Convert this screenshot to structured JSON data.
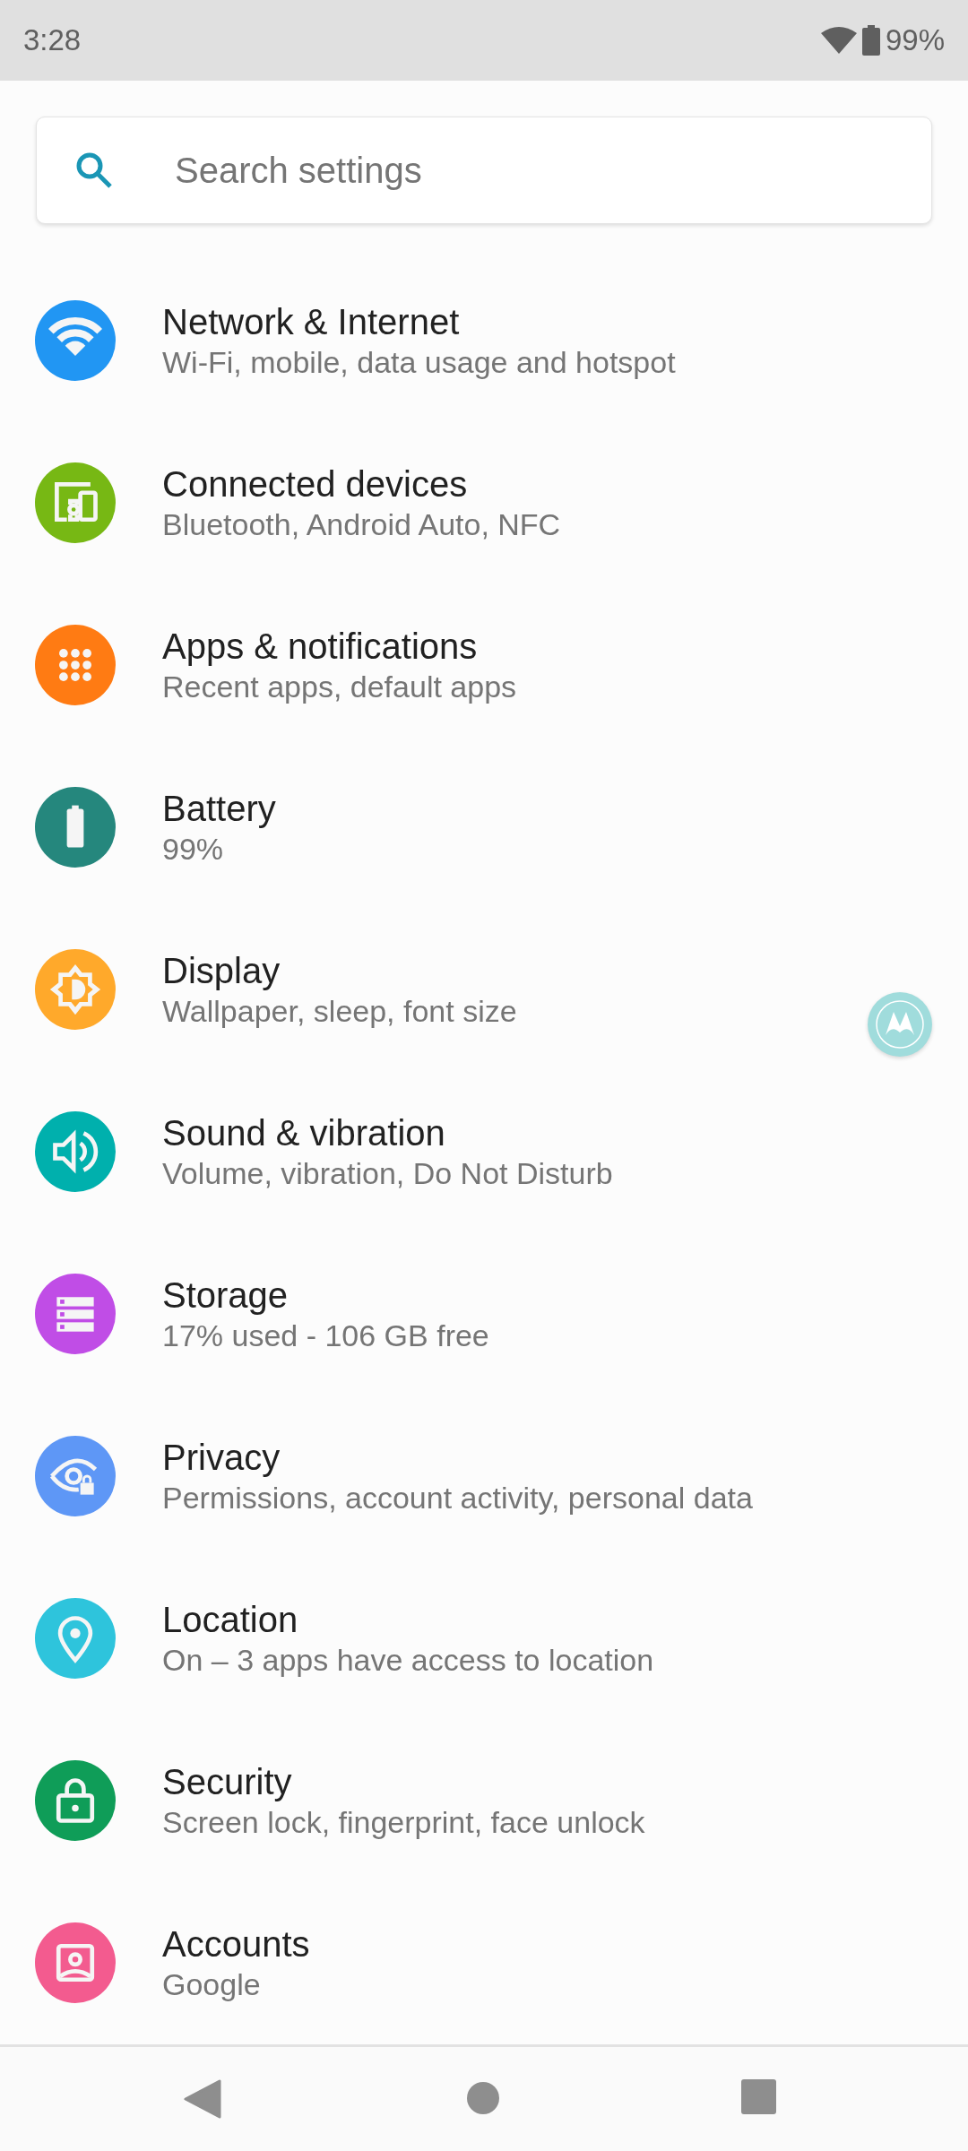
{
  "status_bar": {
    "time": "3:28",
    "battery": "99%"
  },
  "search": {
    "placeholder": "Search settings"
  },
  "settings": [
    {
      "title": "Network & Internet",
      "subtitle": "Wi-Fi, mobile, data usage and hotspot",
      "color": "#2196f3"
    },
    {
      "title": "Connected devices",
      "subtitle": "Bluetooth, Android Auto, NFC",
      "color": "#77b814"
    },
    {
      "title": "Apps & notifications",
      "subtitle": "Recent apps, default apps",
      "color": "#ff7b13"
    },
    {
      "title": "Battery",
      "subtitle": "99%",
      "color": "#25877d"
    },
    {
      "title": "Display",
      "subtitle": "Wallpaper, sleep, font size",
      "color": "#ffa92b"
    },
    {
      "title": "Sound & vibration",
      "subtitle": "Volume, vibration, Do Not Disturb",
      "color": "#00b0ad"
    },
    {
      "title": "Storage",
      "subtitle": "17% used - 106 GB free",
      "color": "#c04de6"
    },
    {
      "title": "Privacy",
      "subtitle": "Permissions, account activity, personal data",
      "color": "#5e97f6"
    },
    {
      "title": "Location",
      "subtitle": "On – 3 apps have access to location",
      "color": "#2ec4dc"
    },
    {
      "title": "Security",
      "subtitle": "Screen lock, fingerprint, face unlock",
      "color": "#0f9d58"
    },
    {
      "title": "Accounts",
      "subtitle": "Google",
      "color": "#f35b8f"
    }
  ]
}
